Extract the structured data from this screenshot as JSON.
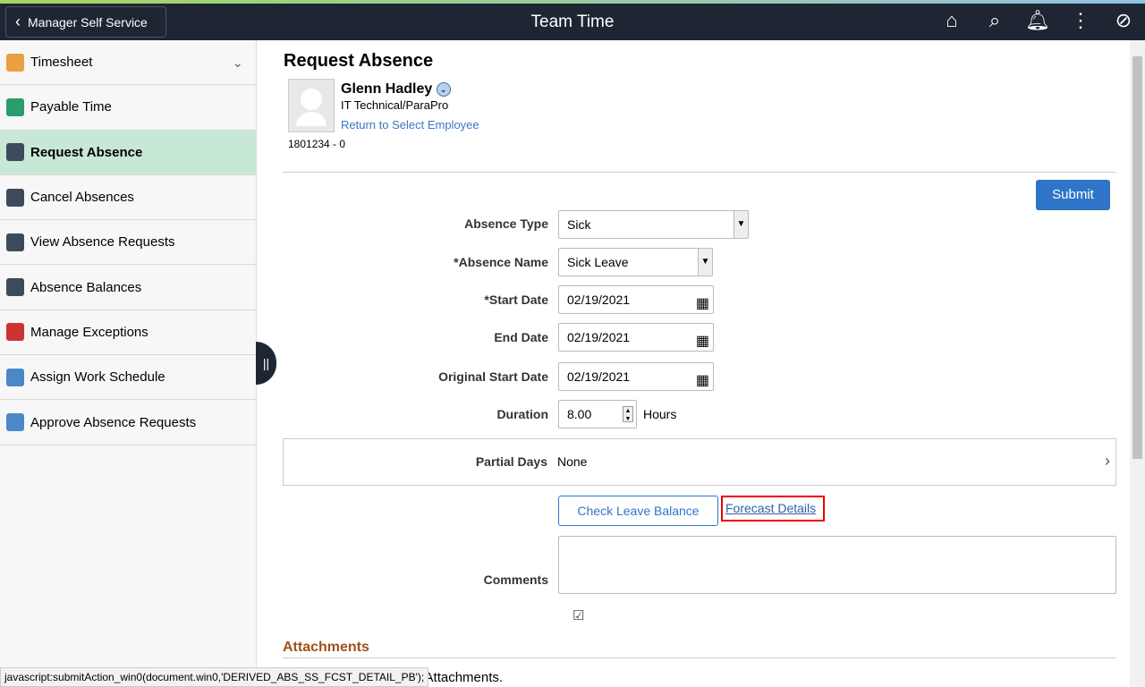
{
  "header": {
    "back_label": "Manager Self Service",
    "title": "Team Time",
    "icons": [
      "home-icon",
      "search-icon",
      "bell-icon",
      "more-icon",
      "compass-icon"
    ]
  },
  "sidebar": {
    "items": [
      {
        "label": "Timesheet",
        "icon": "timesheet-icon",
        "color": "#e8a040",
        "expandable": true
      },
      {
        "label": "Payable Time",
        "icon": "payable-time-icon",
        "color": "#2a9d6a"
      },
      {
        "label": "Request Absence",
        "icon": "briefcase-icon",
        "color": "#3d4a5c",
        "active": true
      },
      {
        "label": "Cancel Absences",
        "icon": "cancel-briefcase-icon",
        "color": "#3d4a5c"
      },
      {
        "label": "View Absence Requests",
        "icon": "calendar-briefcase-icon",
        "color": "#3d4a5c"
      },
      {
        "label": "Absence Balances",
        "icon": "balance-briefcase-icon",
        "color": "#3d4a5c"
      },
      {
        "label": "Manage Exceptions",
        "icon": "exception-clock-icon",
        "color": "#c33"
      },
      {
        "label": "Assign Work Schedule",
        "icon": "schedule-icon",
        "color": "#4a88c8"
      },
      {
        "label": "Approve Absence Requests",
        "icon": "approve-icon",
        "color": "#4a88c8"
      }
    ]
  },
  "main": {
    "title": "Request Absence",
    "employee": {
      "name": "Glenn Hadley",
      "job": "IT Technical/ParaPro",
      "return_link": "Return to Select Employee",
      "id": "1801234 - 0"
    },
    "submit_label": "Submit",
    "fields": {
      "absence_type": {
        "label": "Absence Type",
        "value": "Sick"
      },
      "absence_name": {
        "label": "*Absence Name",
        "value": "Sick Leave"
      },
      "start_date": {
        "label": "*Start Date",
        "value": "02/19/2021"
      },
      "end_date": {
        "label": "End Date",
        "value": "02/19/2021"
      },
      "original_start_date": {
        "label": "Original Start Date",
        "value": "02/19/2021"
      },
      "duration": {
        "label": "Duration",
        "value": "8.00",
        "unit": "Hours"
      },
      "partial_days": {
        "label": "Partial Days",
        "value": "None"
      },
      "comments": {
        "label": "Comments",
        "value": ""
      }
    },
    "check_balance_label": "Check Leave Balance",
    "forecast_label": "Forecast Details",
    "attachments_title": "Attachments",
    "attachments_text": "any Attachments."
  },
  "status_bar": "javascript:submitAction_win0(document.win0,'DERIVED_ABS_SS_FCST_DETAIL_PB');"
}
